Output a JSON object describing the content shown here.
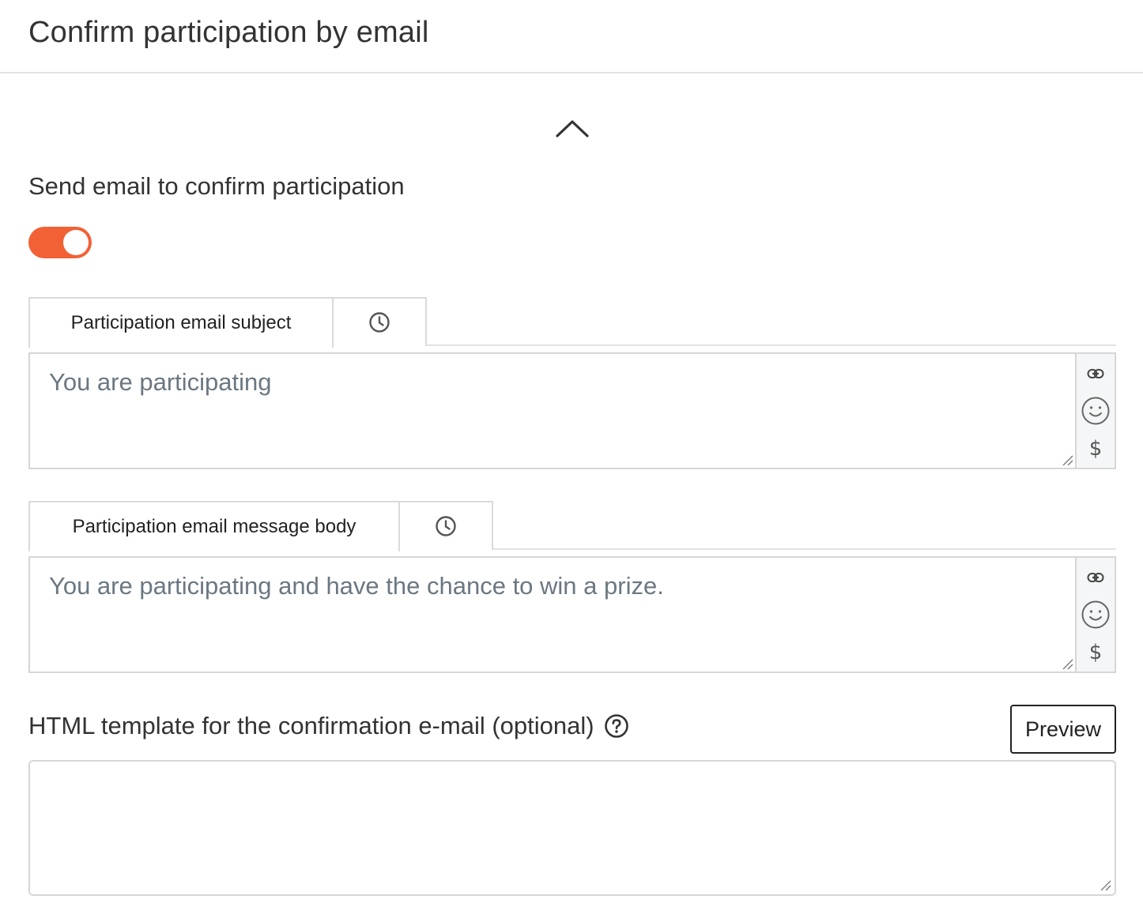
{
  "header": {
    "title": "Confirm participation by email"
  },
  "collapse": {
    "icon": "chevron-up-icon"
  },
  "confirmation": {
    "label": "Send email to confirm participation",
    "toggle_on": true,
    "toggle_color": "#f26135"
  },
  "subject": {
    "tab_label": "Participation email subject",
    "clock_icon": "clock-icon",
    "value": "You are participating",
    "tools": [
      "link-icon",
      "emoji-icon",
      "dollar-icon"
    ],
    "dollar_symbol": "$"
  },
  "body": {
    "tab_label": "Participation email message body",
    "clock_icon": "clock-icon",
    "value": "You are participating and have the chance to win a prize.",
    "tools": [
      "link-icon",
      "emoji-icon",
      "dollar-icon"
    ],
    "dollar_symbol": "$"
  },
  "html_template": {
    "label": "HTML template for the confirmation e-mail (optional)",
    "help_icon": "help-circle-icon",
    "preview_label": "Preview",
    "value": ""
  }
}
